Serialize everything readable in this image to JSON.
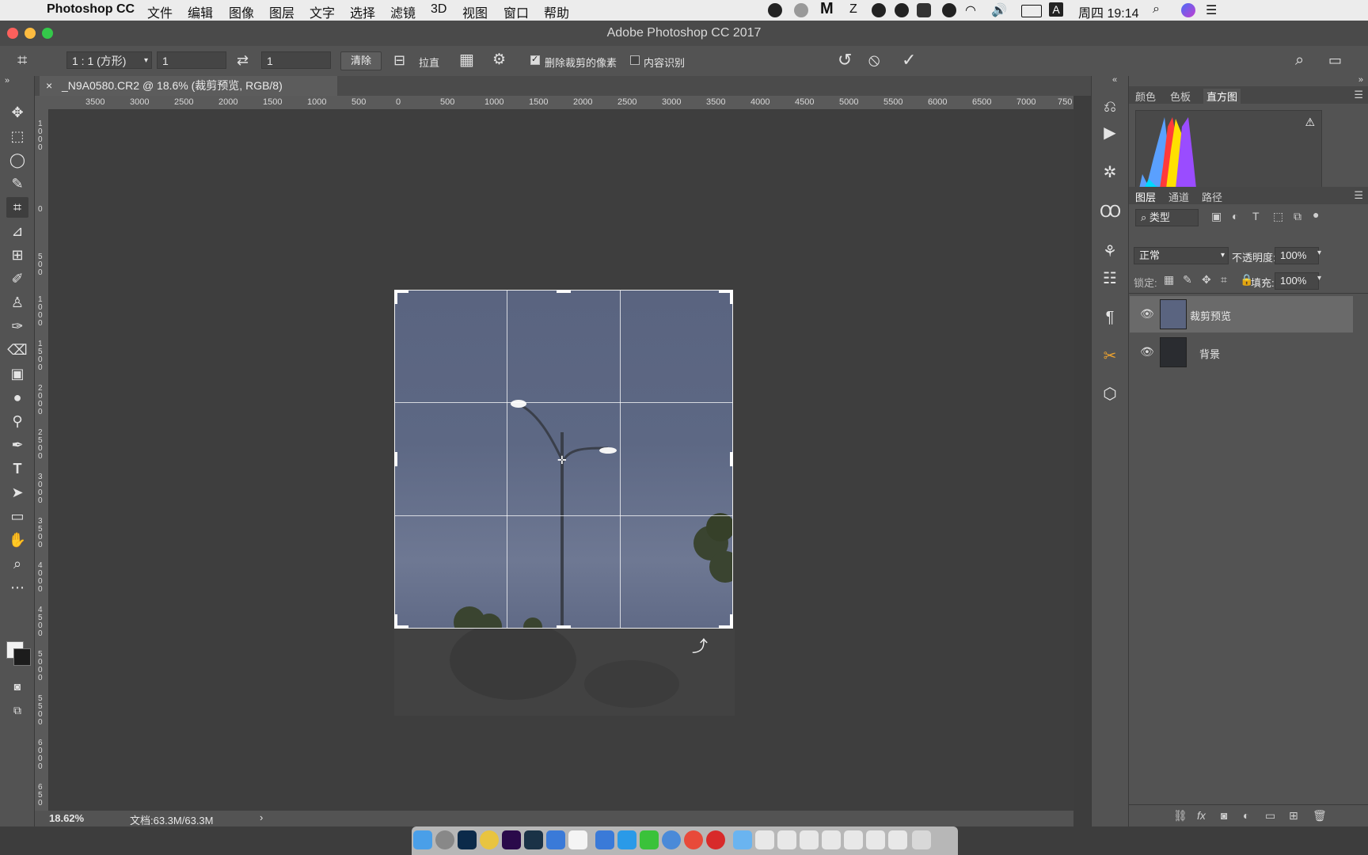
{
  "menubar": {
    "app_name": "Photoshop CC",
    "items": [
      "文件",
      "编辑",
      "图像",
      "图层",
      "文字",
      "选择",
      "滤镜",
      "3D",
      "视图",
      "窗口",
      "帮助"
    ],
    "clock": "周四 19:14",
    "input_method": "A"
  },
  "window": {
    "title": "Adobe Photoshop CC 2017"
  },
  "options": {
    "ratio_select": "1 : 1 (方形)",
    "width_value": "1",
    "height_value": "1",
    "clear_label": "清除",
    "straighten_label": "拉直",
    "delete_cropped_label": "删除裁剪的像素",
    "delete_cropped_checked": true,
    "content_aware_label": "内容识别",
    "content_aware_checked": false
  },
  "document": {
    "tab_title": "_N9A0580.CR2 @ 18.6% (裁剪预览, RGB/8)",
    "close_glyph": "×"
  },
  "ruler": {
    "h_labels": [
      "3500",
      "3000",
      "2500",
      "2000",
      "1500",
      "1000",
      "500",
      "0",
      "500",
      "1000",
      "1500",
      "2000",
      "2500",
      "3000",
      "3500",
      "4000",
      "4500",
      "5000",
      "5500",
      "6000",
      "6500",
      "7000",
      "750"
    ],
    "v_labels": [
      "1000",
      "0",
      "500",
      "1000",
      "1500",
      "2000",
      "2500",
      "3000",
      "3500",
      "4000",
      "4500",
      "5000",
      "5500",
      "6000",
      "650"
    ]
  },
  "status": {
    "zoom": "18.62%",
    "doc_size": "文档:63.3M/63.3M",
    "arrow": "›"
  },
  "panels": {
    "top_tabs": [
      "颜色",
      "色板",
      "直方图"
    ],
    "top_active": "直方图",
    "layer_tabs": [
      "图层",
      "通道",
      "路径"
    ],
    "layer_active": "图层",
    "filter_placeholder": "类型",
    "blend_mode": "正常",
    "opacity_label": "不透明度:",
    "opacity_value": "100%",
    "lock_label": "锁定:",
    "fill_label": "填充:",
    "fill_value": "100%",
    "layers": [
      {
        "name": "裁剪预览",
        "selected": true
      },
      {
        "name": "背景",
        "selected": false
      }
    ]
  },
  "colors": {
    "accent_selection": "#6a6a6a",
    "panel_bg": "#535353",
    "canvas_bg": "#3e3e3e"
  },
  "icons": {
    "tools": [
      "move-icon",
      "marquee-icon",
      "lasso-icon",
      "quick-select-icon",
      "crop-icon",
      "eyedropper-icon",
      "healing-icon",
      "brush-icon",
      "stamp-icon",
      "history-brush-icon",
      "eraser-icon",
      "gradient-icon",
      "blur-icon",
      "dodge-icon",
      "pen-icon",
      "type-icon",
      "path-select-icon",
      "rectangle-icon",
      "hand-icon",
      "zoom-icon",
      "more-icon"
    ],
    "strip": [
      "history-icon",
      "actions-icon",
      "adjust-icon",
      "character-icon",
      "brush-settings-icon",
      "properties-icon",
      "paragraph-icon",
      "tools-icon",
      "3d-icon"
    ]
  }
}
